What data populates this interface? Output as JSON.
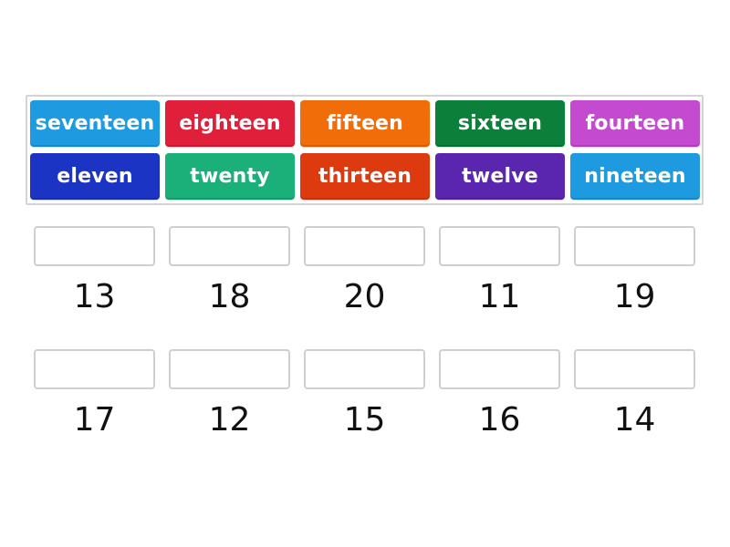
{
  "tiles": [
    {
      "label": "seventeen",
      "color": "#1e9be0"
    },
    {
      "label": "eighteen",
      "color": "#e0203b"
    },
    {
      "label": "fifteen",
      "color": "#f06d0a"
    },
    {
      "label": "sixteen",
      "color": "#0c7f3a"
    },
    {
      "label": "fourteen",
      "color": "#c44bd0"
    },
    {
      "label": "eleven",
      "color": "#1c34c4"
    },
    {
      "label": "twenty",
      "color": "#1bb07a"
    },
    {
      "label": "thirteen",
      "color": "#dd3a10"
    },
    {
      "label": "twelve",
      "color": "#5a26b0"
    },
    {
      "label": "nineteen",
      "color": "#1e9be0"
    }
  ],
  "targets": [
    {
      "number": "13"
    },
    {
      "number": "18"
    },
    {
      "number": "20"
    },
    {
      "number": "11"
    },
    {
      "number": "19"
    },
    {
      "number": "17"
    },
    {
      "number": "12"
    },
    {
      "number": "15"
    },
    {
      "number": "16"
    },
    {
      "number": "14"
    }
  ]
}
